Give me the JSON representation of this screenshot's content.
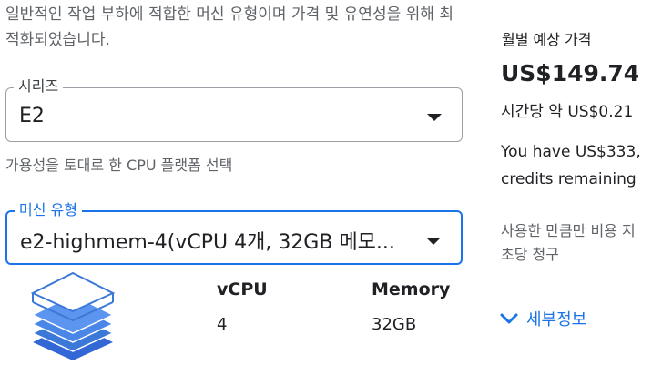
{
  "description": "일반적인 작업 부하에 적합한 머신 유형이며 가격 및 유연성을 위해 최적화되었습니다.",
  "series": {
    "label": "시리즈",
    "value": "E2"
  },
  "cpu_platform_hint": "가용성을 토대로 한 CPU 플랫폼 선택",
  "machine_type": {
    "label": "머신 유형",
    "value": "e2-highmem-4(vCPU 4개, 32GB 메모..."
  },
  "specs": {
    "vcpu_header": "vCPU",
    "vcpu_value": "4",
    "memory_header": "Memory",
    "memory_value": "32GB"
  },
  "estimate": {
    "label": "월별 예상 가격",
    "price": "US$149.74",
    "hourly": "시간당 약 US$0.21",
    "credits_line1": "You have US$333,",
    "credits_line2": "credits remaining",
    "usage_line1": "사용한 만큼만 비용 지",
    "usage_line2": "초당 청구",
    "details_label": "세부정보"
  },
  "colors": {
    "accent": "#1a73e8",
    "illustration": "#3c78d8"
  },
  "icons": {
    "dropdown": "caret-down-icon",
    "details": "chevron-down-icon",
    "illustration": "stacked-layers-icon"
  }
}
